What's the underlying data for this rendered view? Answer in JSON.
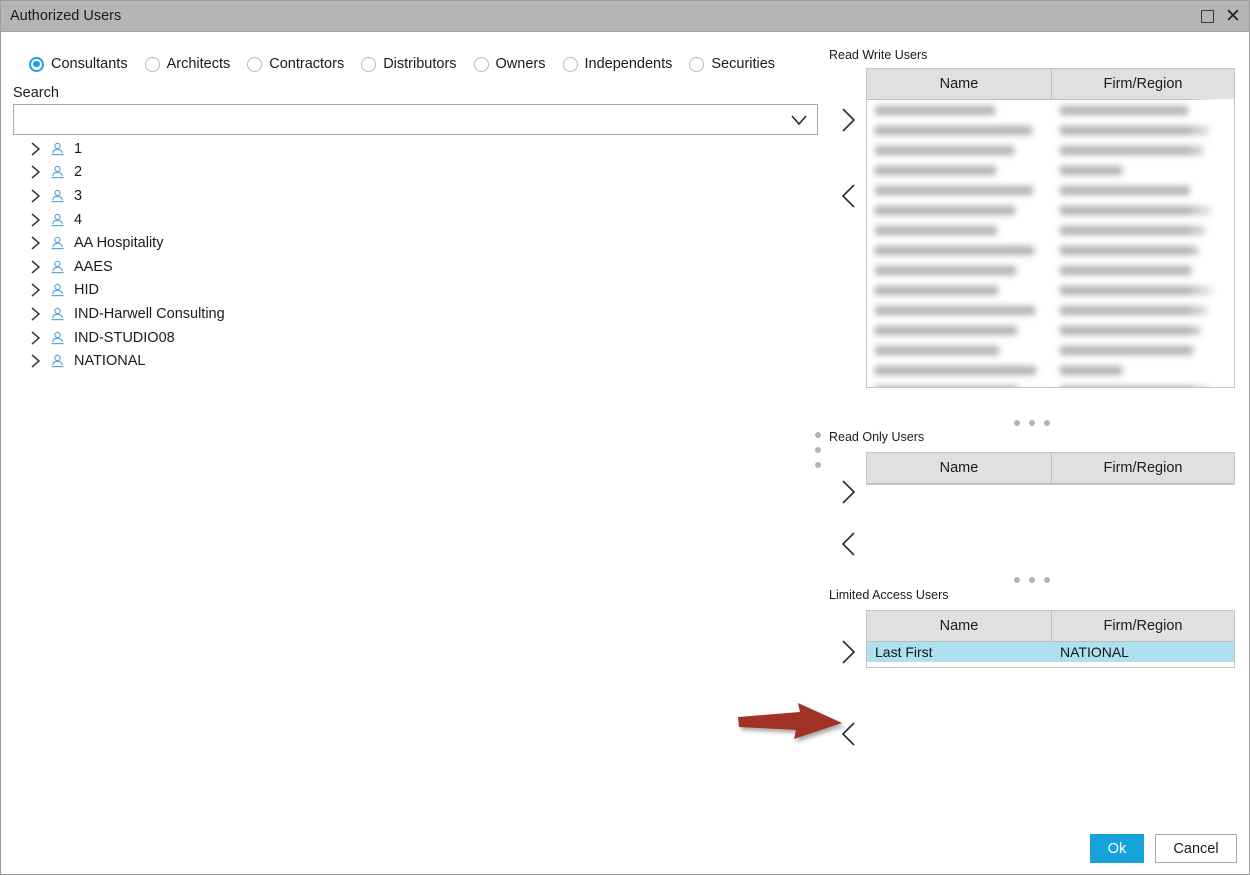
{
  "window": {
    "title": "Authorized Users",
    "maximize_icon": "maximize-icon",
    "close_icon": "close-icon",
    "titlebar_color": "#b5b5b5"
  },
  "filters": {
    "selected": "Consultants",
    "options": [
      {
        "label": "Consultants",
        "checked": true
      },
      {
        "label": "Architects",
        "checked": false
      },
      {
        "label": "Contractors",
        "checked": false
      },
      {
        "label": "Distributors",
        "checked": false
      },
      {
        "label": "Owners",
        "checked": false
      },
      {
        "label": "Independents",
        "checked": false
      },
      {
        "label": "Securities",
        "checked": false
      }
    ],
    "accent_color": "#1ba1e2"
  },
  "search": {
    "label": "Search",
    "value": "",
    "placeholder": "",
    "dropdown_icon": "chevron-down-icon"
  },
  "tree": {
    "expand_icon": "chevron-right-icon",
    "node_icon": "user-icon",
    "items": [
      {
        "label": "1"
      },
      {
        "label": "2"
      },
      {
        "label": "3"
      },
      {
        "label": "4"
      },
      {
        "label": "AA Hospitality"
      },
      {
        "label": "AAES"
      },
      {
        "label": "HID"
      },
      {
        "label": "IND-Harwell Consulting"
      },
      {
        "label": "IND-STUDIO08"
      },
      {
        "label": "NATIONAL"
      }
    ]
  },
  "panels": {
    "read_write": {
      "label": "Read Write Users",
      "columns": [
        "Name",
        "Firm/Region"
      ],
      "add_icon": "chevron-right-icon",
      "remove_icon": "chevron-left-icon",
      "rows_redacted": true,
      "row_count": 15,
      "rows": []
    },
    "read_only": {
      "label": "Read Only Users",
      "columns": [
        "Name",
        "Firm/Region"
      ],
      "add_icon": "chevron-right-icon",
      "remove_icon": "chevron-left-icon",
      "rows": []
    },
    "limited_access": {
      "label": "Limited Access Users",
      "columns": [
        "Name",
        "Firm/Region"
      ],
      "add_icon": "chevron-right-icon",
      "remove_icon": "chevron-left-icon",
      "selected_row_color": "#aee0f0",
      "rows": [
        {
          "name": "Last First",
          "firm": "NATIONAL",
          "selected": true
        }
      ]
    }
  },
  "annotation": {
    "type": "arrow",
    "color": "#a03228",
    "points_to": "limited-access-remove-button"
  },
  "footer": {
    "ok_label": "Ok",
    "cancel_label": "Cancel",
    "ok_color": "#18a2dc"
  }
}
